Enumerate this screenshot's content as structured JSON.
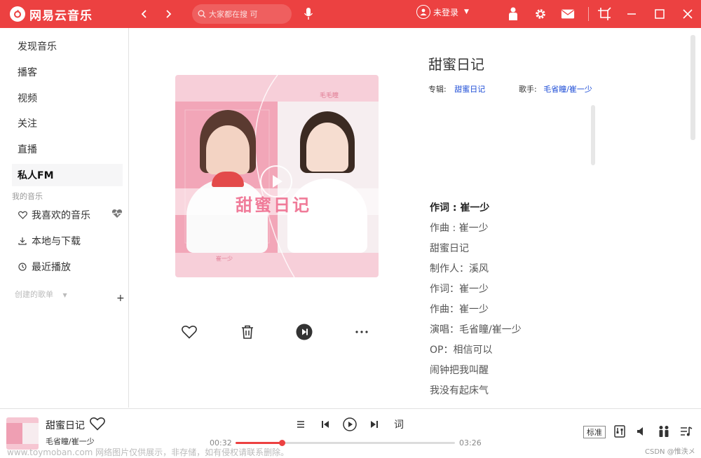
{
  "app": {
    "name": "网易云音乐",
    "brand_color": "#ec4141"
  },
  "topbar": {
    "back_icon": "chevron-left-icon",
    "forward_icon": "chevron-right-icon",
    "search_placeholder": "大家都在搜 可",
    "user_label": "未登录"
  },
  "sidebar": {
    "items": [
      {
        "label": "发现音乐"
      },
      {
        "label": "播客"
      },
      {
        "label": "视频"
      },
      {
        "label": "关注"
      },
      {
        "label": "直播"
      },
      {
        "label": "私人FM"
      }
    ],
    "my_music_title": "我的音乐",
    "my_music": [
      {
        "label": "我喜欢的音乐",
        "icon": "heart-outline-icon"
      },
      {
        "label": "本地与下载",
        "icon": "download-icon"
      },
      {
        "label": "最近播放",
        "icon": "clock-icon"
      }
    ],
    "created_playlists_title": "创建的歌单",
    "plus": "+"
  },
  "cover_art": {
    "artist_top": "毛毛瞳",
    "title_art": "甜蜜日记",
    "artist_bottom": "崔一少"
  },
  "song": {
    "title": "甜蜜日记",
    "album_label": "专辑:",
    "album": "甜蜜日记",
    "artist_label": "歌手:",
    "artist": "毛省瞳/崔一少"
  },
  "lyrics": [
    "作词 : 崔一少",
    "作曲 : 崔一少",
    "甜蜜日记",
    "制作人：溪风",
    "作词：崔一少",
    "作曲：崔一少",
    "演唱：毛省瞳/崔一少",
    "OP：相信可以",
    "闹钟把我叫醒",
    "我没有起床气"
  ],
  "player": {
    "title": "甜蜜日记",
    "artist": "毛省瞳/崔一少",
    "current_time": "00:32",
    "total_time": "03:26",
    "progress": 0.21,
    "lyric_button": "词",
    "quality": "标准"
  },
  "watermark": "www.toymoban.com 网络图片仅供展示，非存储，如有侵权请联系删除。",
  "credit": "CSDN @惟泆メ"
}
